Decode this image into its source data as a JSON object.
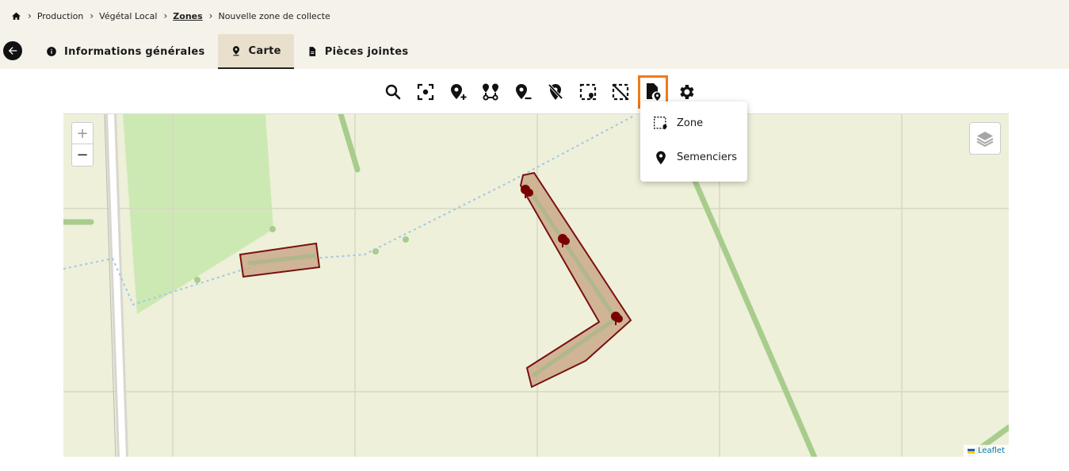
{
  "breadcrumb": {
    "home_icon": "home-icon",
    "items": [
      "Production",
      "Végétal Local",
      "Zones",
      "Nouvelle zone de collecte"
    ]
  },
  "tabs": [
    {
      "label": "Informations générales",
      "icon": "info-icon"
    },
    {
      "label": "Carte",
      "icon": "map-pin-icon",
      "active": true
    },
    {
      "label": "Pièces jointes",
      "icon": "document-icon"
    }
  ],
  "toolbar": {
    "tools": [
      "search-icon",
      "locate-icon",
      "add-marker-icon",
      "route-icon",
      "remove-marker-icon",
      "marker-off-icon",
      "select-area-icon",
      "deselect-area-icon",
      "file-location-icon",
      "settings-icon"
    ],
    "highlighted": "file-location-icon",
    "highlight_color": "#f07a1a"
  },
  "map": {
    "zoom_in": "+",
    "zoom_out": "−",
    "attribution": "Leaflet",
    "zone_fill": "#c9a98a",
    "zone_stroke": "#7a1010"
  },
  "dropdown": {
    "items": [
      {
        "label": "Zone",
        "icon": "zone-icon"
      },
      {
        "label": "Semenciers",
        "icon": "pin-icon"
      }
    ]
  }
}
